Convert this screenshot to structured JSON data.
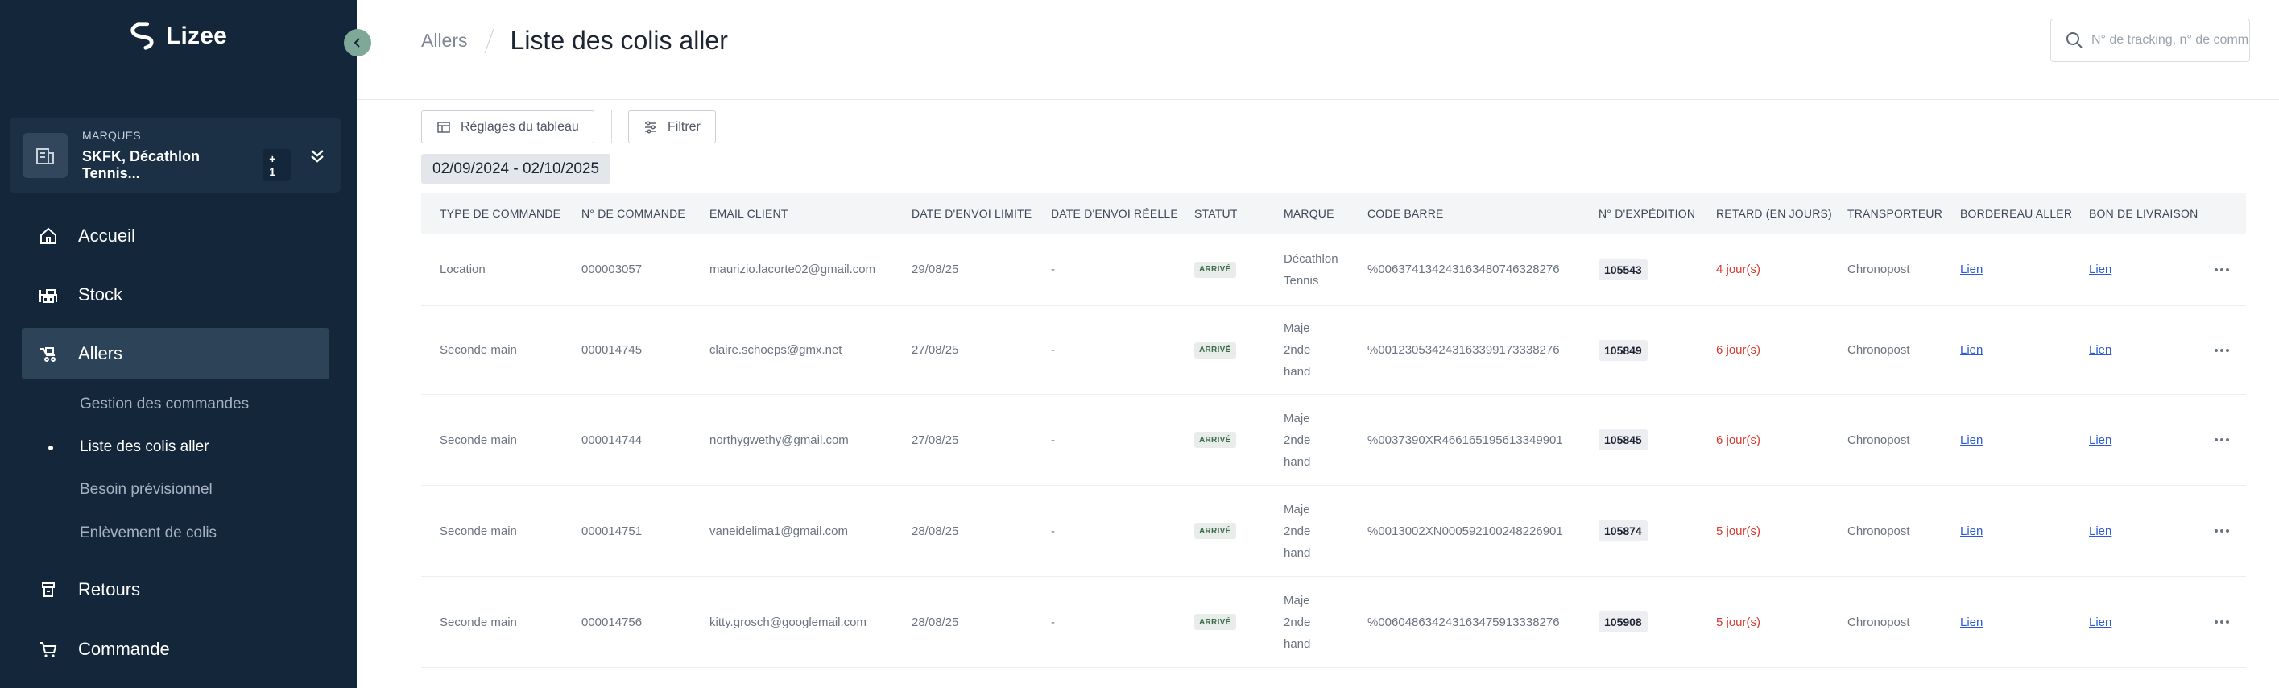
{
  "app": {
    "logo_text": "Lizee"
  },
  "sidebar": {
    "brand_label": "MARQUES",
    "brand_name": "SKFK, Décathlon Tennis...",
    "brand_count": "+ 1",
    "nav": [
      {
        "label": "Accueil",
        "icon": "home-icon"
      },
      {
        "label": "Stock",
        "icon": "warehouse-icon"
      },
      {
        "label": "Allers",
        "icon": "truck-icon"
      },
      {
        "label": "Retours",
        "icon": "return-icon"
      },
      {
        "label": "Commande",
        "icon": "cart-icon"
      }
    ],
    "subnav": [
      {
        "label": "Gestion des commandes"
      },
      {
        "label": "Liste des colis aller"
      },
      {
        "label": "Besoin prévisionnel"
      },
      {
        "label": "Enlèvement de colis"
      }
    ]
  },
  "header": {
    "breadcrumb_parent": "Allers",
    "title": "Liste des colis aller",
    "search_placeholder": "N° de tracking, n° de commande"
  },
  "toolbar": {
    "table_settings_label": "Réglages du tableau",
    "filter_label": "Filtrer",
    "date_range": "02/09/2024 - 02/10/2025"
  },
  "table": {
    "columns": [
      "TYPE DE COMMANDE",
      "N° DE COMMANDE",
      "EMAIL CLIENT",
      "DATE D'ENVOI LIMITE",
      "DATE D'ENVOI RÉELLE",
      "STATUT",
      "MARQUE",
      "CODE BARRE",
      "N° D'EXPÉDITION",
      "RETARD (EN JOURS)",
      "TRANSPORTEUR",
      "BORDEREAU ALLER",
      "BON DE LIVRAISON"
    ],
    "rows": [
      {
        "type": "Location",
        "order": "000003057",
        "email": "maurizio.lacorte02@gmail.com",
        "limit_date": "29/08/25",
        "real_date": "-",
        "status": "ARRIVÉ",
        "brand": "Décathlon Tennis",
        "barcode": "%0063741342431634807463282​76",
        "shipment": "105543",
        "delay": "4 jour(s)",
        "carrier": "Chronopost",
        "slip": "Lien",
        "delivery_note": "Lien"
      },
      {
        "type": "Seconde main",
        "order": "000014745",
        "email": "claire.schoeps@gmx.net",
        "limit_date": "27/08/25",
        "real_date": "-",
        "status": "ARRIVÉ",
        "brand": "Maje 2nde hand",
        "barcode": "%00123053424316339917333827​6",
        "shipment": "105849",
        "delay": "6 jour(s)",
        "carrier": "Chronopost",
        "slip": "Lien",
        "delivery_note": "Lien"
      },
      {
        "type": "Seconde main",
        "order": "000014744",
        "email": "northygwethy@gmail.com",
        "limit_date": "27/08/25",
        "real_date": "-",
        "status": "ARRIVÉ",
        "brand": "Maje 2nde hand",
        "barcode": "%0037390XR466165195613349901",
        "shipment": "105845",
        "delay": "6 jour(s)",
        "carrier": "Chronopost",
        "slip": "Lien",
        "delivery_note": "Lien"
      },
      {
        "type": "Seconde main",
        "order": "000014751",
        "email": "vaneidelima1@gmail.com",
        "limit_date": "28/08/25",
        "real_date": "-",
        "status": "ARRIVÉ",
        "brand": "Maje 2nde hand",
        "barcode": "%0013002XN000592100248226901",
        "shipment": "105874",
        "delay": "5 jour(s)",
        "carrier": "Chronopost",
        "slip": "Lien",
        "delivery_note": "Lien"
      },
      {
        "type": "Seconde main",
        "order": "000014756",
        "email": "kitty.grosch@googlemail.com",
        "limit_date": "28/08/25",
        "real_date": "-",
        "status": "ARRIVÉ",
        "brand": "Maje 2nde hand",
        "barcode": "%006048634243163475913338276",
        "shipment": "105908",
        "delay": "5 jour(s)",
        "carrier": "Chronopost",
        "slip": "Lien",
        "delivery_note": "Lien"
      }
    ]
  }
}
